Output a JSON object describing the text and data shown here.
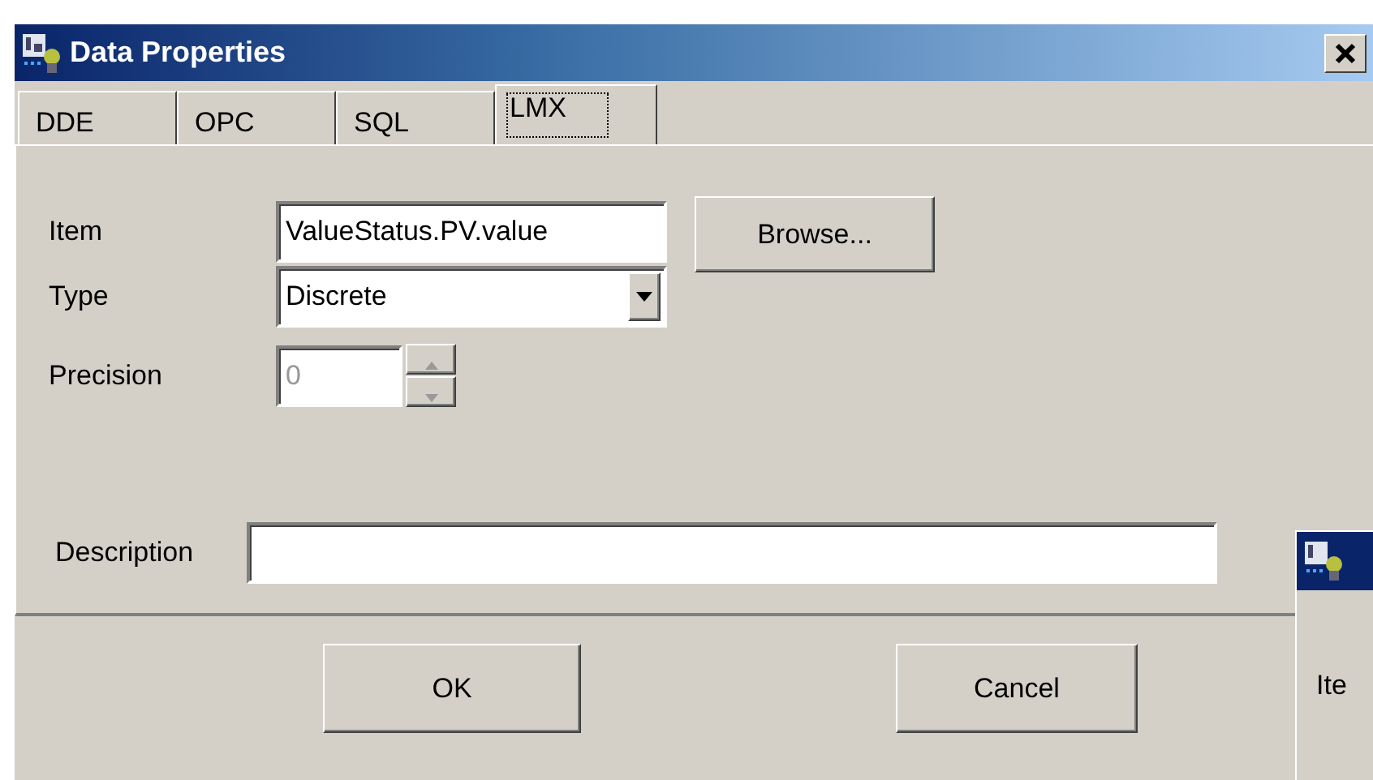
{
  "window": {
    "title": "Data Properties"
  },
  "tabs": [
    {
      "label": "DDE",
      "selected": false
    },
    {
      "label": "OPC",
      "selected": false
    },
    {
      "label": "SQL",
      "selected": false
    },
    {
      "label": "LMX",
      "selected": true
    }
  ],
  "form": {
    "item": {
      "label": "Item",
      "value": "ValueStatus.PV.value"
    },
    "browse_button": "Browse...",
    "type": {
      "label": "Type",
      "value": "Discrete"
    },
    "precision": {
      "label": "Precision",
      "value": "0",
      "disabled": true
    },
    "description": {
      "label": "Description"
    }
  },
  "buttons": [
    "OK",
    "Cancel"
  ],
  "background_window": {
    "label": "Ite"
  }
}
